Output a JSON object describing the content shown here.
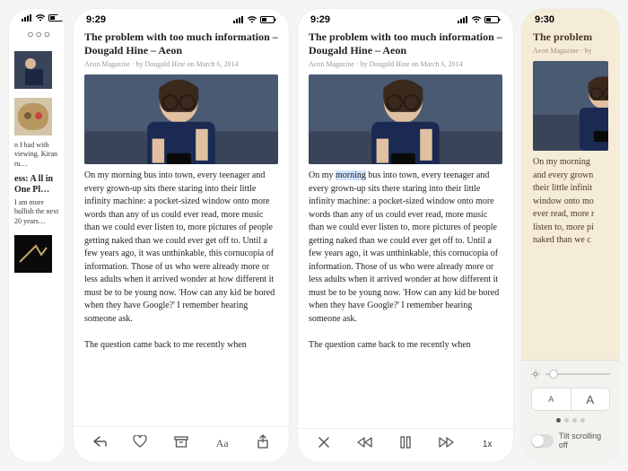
{
  "status": {
    "time_a": "9:29",
    "time_b": "9:30"
  },
  "article": {
    "title": "The problem with too much information – Dougald Hine – Aeon",
    "meta": "Aeon Magazine · by Dougald Hine on March 6, 2014",
    "body_p1": "On my morning bus into town, every teenager and every grown-up sits there staring into their little infinity machine: a pocket-sized window onto more words than any of us could ever read, more music than we could ever listen to, more pictures of people getting naked than we could ever get off to. Until a few years ago, it was unthinkable, this cornucopia of information. Those of us who were already more or less adults when it arrived wonder at how different it must be to be young now. 'How can any kid be bored when they have Google?' I remember hearing someone ask.",
    "body_p2": "The question came back to me recently when",
    "highlight_word": "morning",
    "title_truncated": "The problem",
    "meta_truncated": "Aeon Magazine · by",
    "body_truncated_lines": "On my morning\nand every grown\ntheir little infinit\nwindow onto mo\never read, more r\nlisten to, more pi\nnaked than we c"
  },
  "list": {
    "snippet1": "n I had with viewing. Kiran ru…",
    "title2": "ess: A ll in One Pl…",
    "snippet3": "I am more bullish the next 20 years…"
  },
  "reader_toolbar": {
    "speed": "1x"
  },
  "settings": {
    "font_small": "A",
    "font_large": "A",
    "tilt_label": "Tilt scrolling off"
  }
}
